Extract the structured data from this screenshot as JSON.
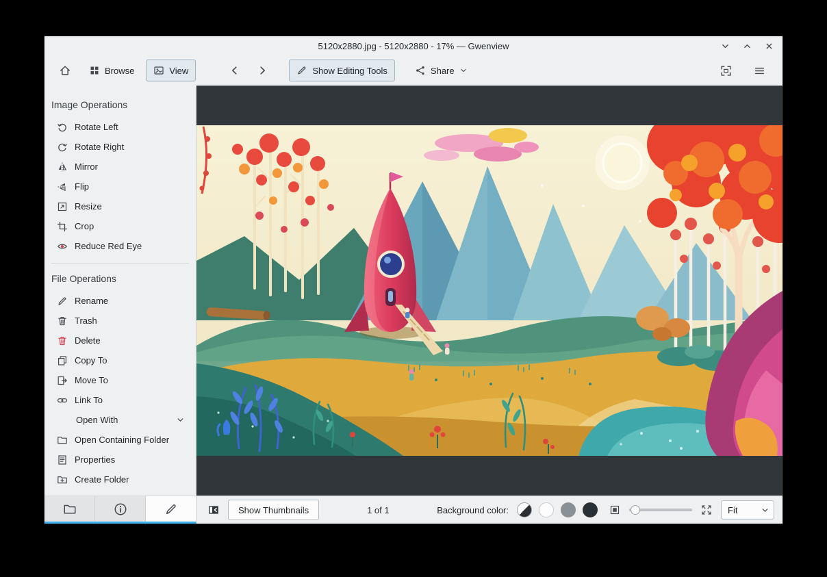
{
  "window": {
    "title": "5120x2880.jpg - 5120x2880 - 17% — Gwenview"
  },
  "colors": {
    "accent": "#3daee9",
    "view_background": "#31363b",
    "chrome_background": "#eff0f1",
    "delete_red": "#da4453"
  },
  "toolbar": {
    "browse": "Browse",
    "view": "View",
    "show_editing_tools": "Show Editing Tools",
    "share": "Share"
  },
  "sidebar": {
    "image_operations": {
      "title": "Image Operations",
      "items": [
        {
          "label": "Rotate Left",
          "icon": "rotate-left-icon"
        },
        {
          "label": "Rotate Right",
          "icon": "rotate-right-icon"
        },
        {
          "label": "Mirror",
          "icon": "mirror-icon"
        },
        {
          "label": "Flip",
          "icon": "flip-icon"
        },
        {
          "label": "Resize",
          "icon": "resize-icon"
        },
        {
          "label": "Crop",
          "icon": "crop-icon"
        },
        {
          "label": "Reduce Red Eye",
          "icon": "reduce-red-eye-icon"
        }
      ]
    },
    "file_operations": {
      "title": "File Operations",
      "items": [
        {
          "label": "Rename",
          "icon": "rename-icon"
        },
        {
          "label": "Trash",
          "icon": "trash-icon"
        },
        {
          "label": "Delete",
          "icon": "delete-icon"
        },
        {
          "label": "Copy To",
          "icon": "copy-to-icon"
        },
        {
          "label": "Move To",
          "icon": "move-to-icon"
        },
        {
          "label": "Link To",
          "icon": "link-to-icon"
        },
        {
          "label": "Open With",
          "icon": "none"
        },
        {
          "label": "Open Containing Folder",
          "icon": "folder-open-icon"
        },
        {
          "label": "Properties",
          "icon": "properties-icon"
        },
        {
          "label": "Create Folder",
          "icon": "create-folder-icon"
        }
      ]
    },
    "tabs": [
      {
        "name": "folder",
        "icon": "folder-icon",
        "active": false
      },
      {
        "name": "information",
        "icon": "info-icon",
        "active": false
      },
      {
        "name": "operations",
        "icon": "pencil-icon",
        "active": true
      }
    ]
  },
  "statusbar": {
    "show_thumbnails": "Show Thumbnails",
    "page_indicator": "1 of 1",
    "background_color_label": "Background color:",
    "background_swatches": [
      "auto",
      "white",
      "gray",
      "dark"
    ],
    "zoom_mode": "Fit"
  }
}
